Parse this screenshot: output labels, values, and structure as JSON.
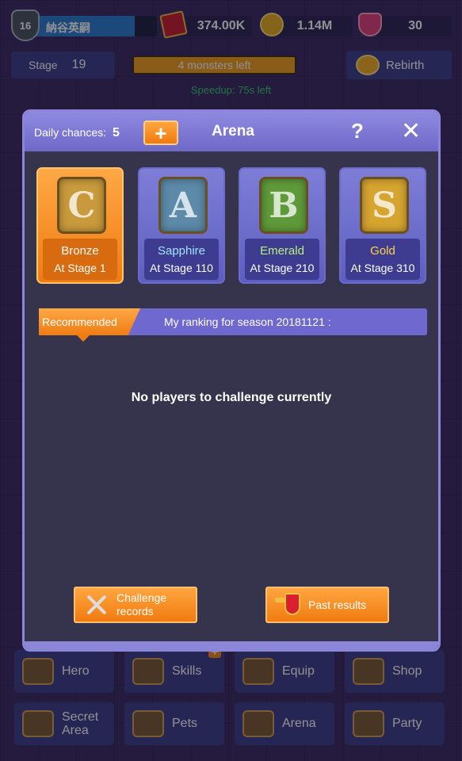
{
  "top_bar": {
    "player_level": "16",
    "player_name": "納谷英嗣",
    "xp_progress": 0.82,
    "scrolls": "374.00K",
    "gold": "1.14M",
    "gems": "30"
  },
  "stage": {
    "label": "Stage",
    "number": "19"
  },
  "monsters_left": "4 monsters left",
  "rebirth_label": "Rebirth",
  "speedup_text": "Speedup: 75s left",
  "arena": {
    "daily_chances_label": "Daily chances:",
    "daily_chances_value": "5",
    "plus_label": "+",
    "title": "Arena",
    "help_label": "?",
    "close_label": "✕",
    "tiers": [
      {
        "name": "Bronze",
        "stage": "At Stage 1",
        "emblem_letter": "C",
        "name_color": "#ffffff",
        "emblem_color": "#c99a3c",
        "selected": true
      },
      {
        "name": "Sapphire",
        "stage": "At Stage 110",
        "emblem_letter": "A",
        "name_color": "#9fe4ff",
        "emblem_color": "#5c8aa8",
        "selected": false
      },
      {
        "name": "Emerald",
        "stage": "At Stage 210",
        "emblem_letter": "B",
        "name_color": "#b6f07a",
        "emblem_color": "#5f9a3a",
        "selected": false
      },
      {
        "name": "Gold",
        "stage": "At Stage 310",
        "emblem_letter": "S",
        "name_color": "#ffd24a",
        "emblem_color": "#d6a530",
        "selected": false
      }
    ],
    "recommended_label": "Recommended",
    "ranking_text": "My ranking for season 20181121 :",
    "empty_message": "No players to challenge currently",
    "challenge_records_label": "Challenge records",
    "past_results_label": "Past results"
  },
  "nav": [
    {
      "label": "Hero",
      "icon": "hero-icon",
      "plus": false
    },
    {
      "label": "Skills",
      "icon": "skills-icon",
      "plus": true
    },
    {
      "label": "Equip",
      "icon": "equip-icon",
      "plus": false
    },
    {
      "label": "Shop",
      "icon": "shop-icon",
      "plus": false
    },
    {
      "label": "Secret Area",
      "icon": "secret-area-icon",
      "plus": false
    },
    {
      "label": "Pets",
      "icon": "pets-icon",
      "plus": false
    },
    {
      "label": "Arena",
      "icon": "arena-icon",
      "plus": false
    },
    {
      "label": "Party",
      "icon": "party-icon",
      "plus": false
    }
  ]
}
